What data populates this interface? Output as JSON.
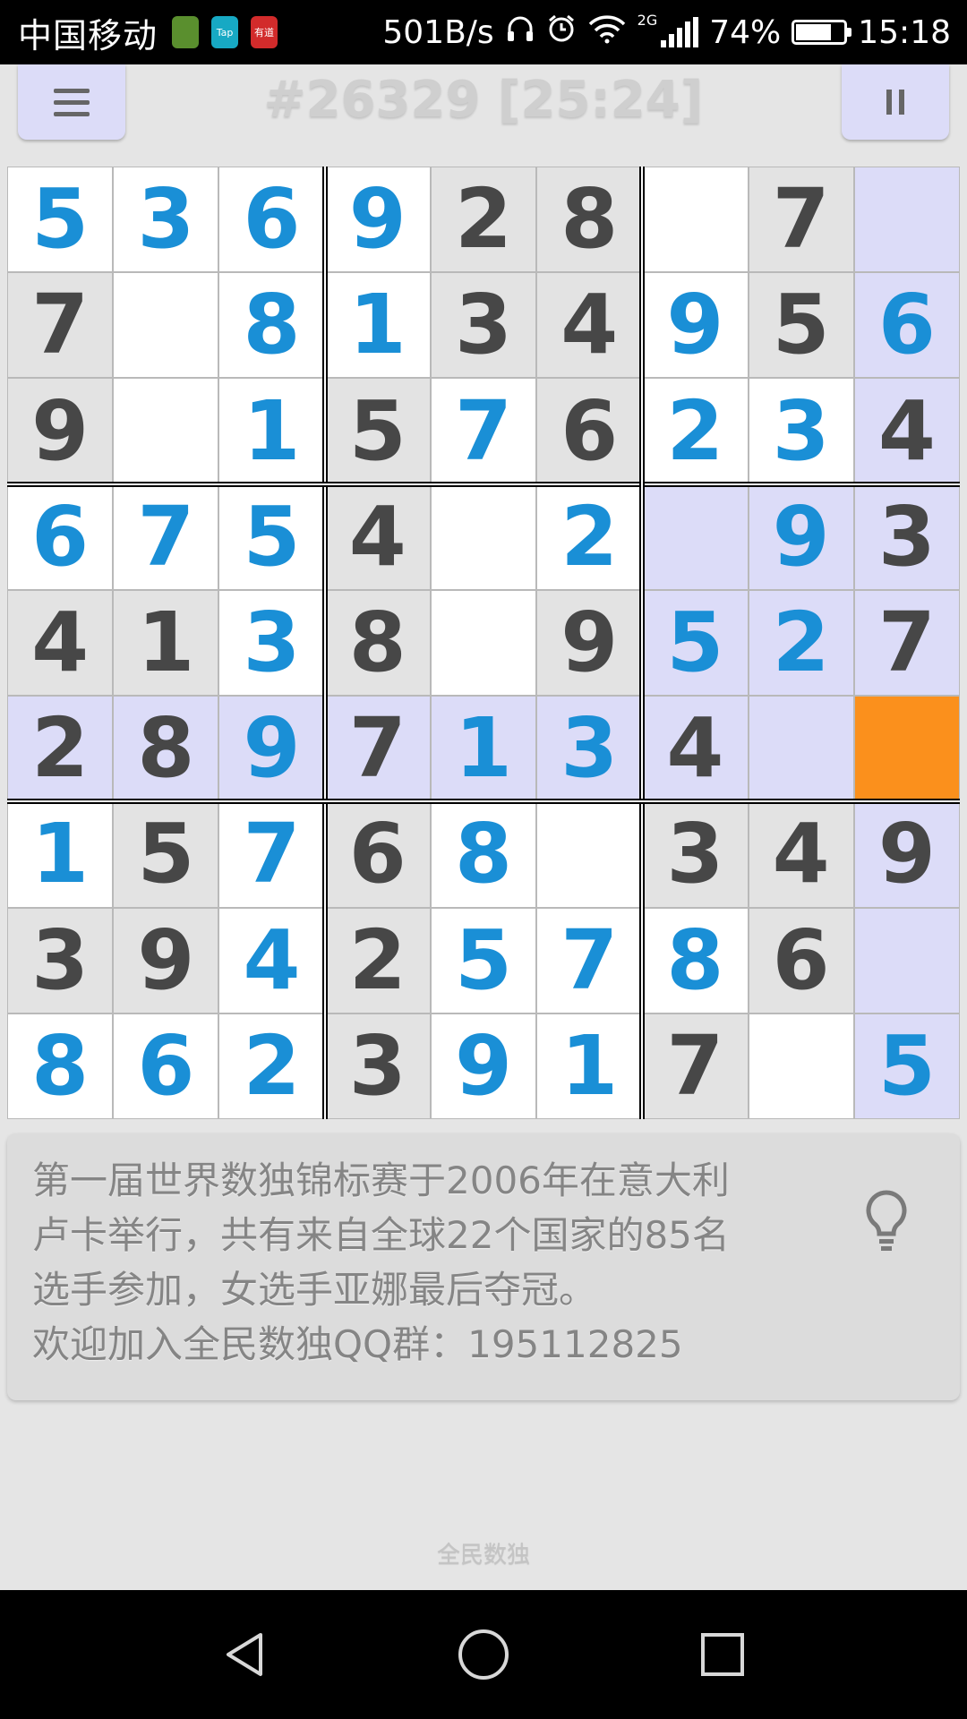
{
  "status_bar": {
    "carrier": "中国移动",
    "notification_apps": [
      {
        "name": "app-notification-icon",
        "label": "",
        "color": "#5a8f2e"
      },
      {
        "name": "taptap-icon",
        "label": "Tap",
        "color": "#17a9c4"
      },
      {
        "name": "app-red-icon",
        "label": "有道",
        "color": "#d22b2b"
      }
    ],
    "net_speed": "501B/s",
    "network_type": "2G",
    "battery_percent": "74%",
    "battery_level": 0.74,
    "time": "15:18"
  },
  "header": {
    "title": "#26329 [25:24]"
  },
  "board": {
    "size": 9,
    "cells": [
      [
        {
          "v": "5",
          "t": "e"
        },
        {
          "v": "3",
          "t": "e"
        },
        {
          "v": "6",
          "t": "e"
        },
        {
          "v": "9",
          "t": "e"
        },
        {
          "v": "2",
          "t": "g"
        },
        {
          "v": "8",
          "t": "g"
        },
        {
          "v": "",
          "t": ""
        },
        {
          "v": "7",
          "t": "g"
        },
        {
          "v": "",
          "t": ""
        }
      ],
      [
        {
          "v": "7",
          "t": "g"
        },
        {
          "v": "",
          "t": ""
        },
        {
          "v": "8",
          "t": "e"
        },
        {
          "v": "1",
          "t": "e"
        },
        {
          "v": "3",
          "t": "g"
        },
        {
          "v": "4",
          "t": "g"
        },
        {
          "v": "9",
          "t": "e"
        },
        {
          "v": "5",
          "t": "g"
        },
        {
          "v": "6",
          "t": "e"
        }
      ],
      [
        {
          "v": "9",
          "t": "g"
        },
        {
          "v": "",
          "t": ""
        },
        {
          "v": "1",
          "t": "e"
        },
        {
          "v": "5",
          "t": "g"
        },
        {
          "v": "7",
          "t": "e"
        },
        {
          "v": "6",
          "t": "g"
        },
        {
          "v": "2",
          "t": "e"
        },
        {
          "v": "3",
          "t": "e"
        },
        {
          "v": "4",
          "t": "g"
        }
      ],
      [
        {
          "v": "6",
          "t": "e"
        },
        {
          "v": "7",
          "t": "e"
        },
        {
          "v": "5",
          "t": "e"
        },
        {
          "v": "4",
          "t": "g"
        },
        {
          "v": "",
          "t": ""
        },
        {
          "v": "2",
          "t": "e"
        },
        {
          "v": "",
          "t": ""
        },
        {
          "v": "9",
          "t": "e"
        },
        {
          "v": "3",
          "t": "g"
        }
      ],
      [
        {
          "v": "4",
          "t": "g"
        },
        {
          "v": "1",
          "t": "g"
        },
        {
          "v": "3",
          "t": "e"
        },
        {
          "v": "8",
          "t": "g"
        },
        {
          "v": "",
          "t": ""
        },
        {
          "v": "9",
          "t": "g"
        },
        {
          "v": "5",
          "t": "e"
        },
        {
          "v": "2",
          "t": "e"
        },
        {
          "v": "7",
          "t": "g"
        }
      ],
      [
        {
          "v": "2",
          "t": "g"
        },
        {
          "v": "8",
          "t": "g"
        },
        {
          "v": "9",
          "t": "e"
        },
        {
          "v": "7",
          "t": "g"
        },
        {
          "v": "1",
          "t": "e"
        },
        {
          "v": "3",
          "t": "e"
        },
        {
          "v": "4",
          "t": "g"
        },
        {
          "v": "",
          "t": ""
        },
        {
          "v": "",
          "t": ""
        }
      ],
      [
        {
          "v": "1",
          "t": "e"
        },
        {
          "v": "5",
          "t": "g"
        },
        {
          "v": "7",
          "t": "e"
        },
        {
          "v": "6",
          "t": "g"
        },
        {
          "v": "8",
          "t": "e"
        },
        {
          "v": "",
          "t": ""
        },
        {
          "v": "3",
          "t": "g"
        },
        {
          "v": "4",
          "t": "g"
        },
        {
          "v": "9",
          "t": "g"
        }
      ],
      [
        {
          "v": "3",
          "t": "g"
        },
        {
          "v": "9",
          "t": "g"
        },
        {
          "v": "4",
          "t": "e"
        },
        {
          "v": "2",
          "t": "g"
        },
        {
          "v": "5",
          "t": "e"
        },
        {
          "v": "7",
          "t": "e"
        },
        {
          "v": "8",
          "t": "e"
        },
        {
          "v": "6",
          "t": "g"
        },
        {
          "v": "",
          "t": ""
        }
      ],
      [
        {
          "v": "8",
          "t": "e"
        },
        {
          "v": "6",
          "t": "e"
        },
        {
          "v": "2",
          "t": "e"
        },
        {
          "v": "3",
          "t": "g"
        },
        {
          "v": "9",
          "t": "e"
        },
        {
          "v": "1",
          "t": "e"
        },
        {
          "v": "7",
          "t": "g"
        },
        {
          "v": "",
          "t": ""
        },
        {
          "v": "5",
          "t": "e"
        }
      ]
    ],
    "selected": [
      5,
      8
    ],
    "colors": {
      "given_bg": "#e3e3e3",
      "empty_bg": "#ffffff",
      "highlight_bg": "#dcdcf8",
      "selected_bg": "#fb901c",
      "given_text": "#474747",
      "entered_text": "#1a8fd6"
    }
  },
  "tip": {
    "lines": [
      "第一届世界数独锦标赛于2006年在意大利",
      "卢卡举行，共有来自全球22个国家的85名",
      "选手参加，女选手亚娜最后夺冠。",
      "欢迎加入全民数独QQ群：195112825"
    ],
    "icon": "lightbulb-icon"
  },
  "footer": {
    "app_name": "全民数独"
  },
  "nav_bar": {
    "icons": [
      "back-icon",
      "home-icon",
      "recents-icon"
    ]
  }
}
